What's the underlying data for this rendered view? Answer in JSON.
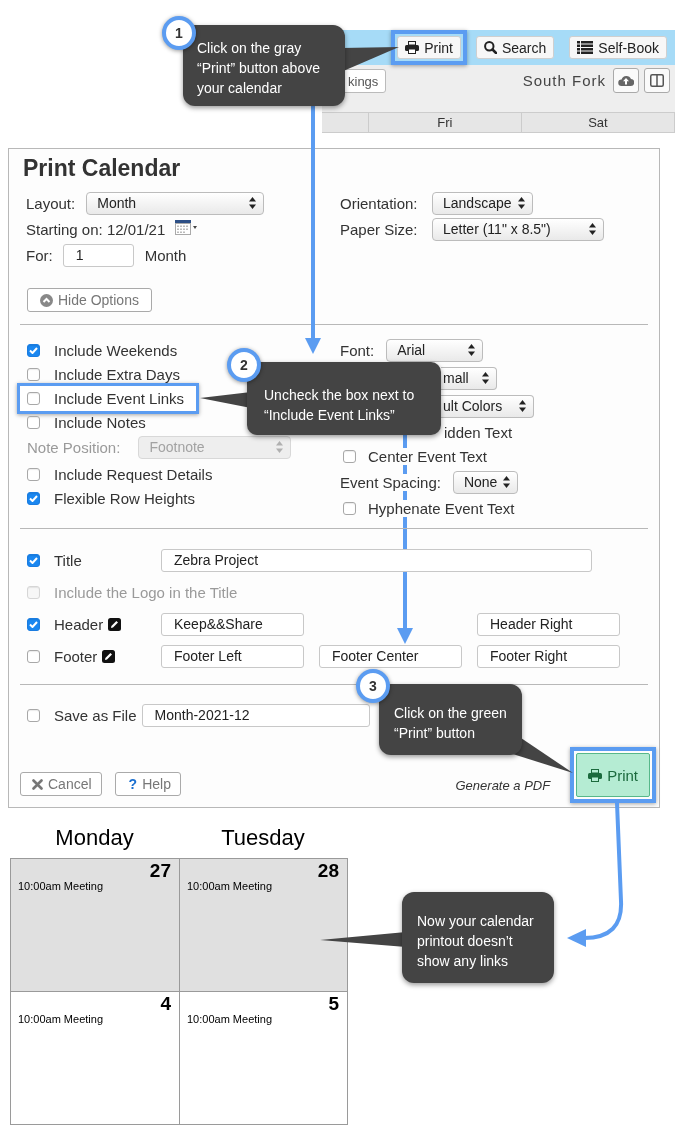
{
  "annotations": {
    "callouts": [
      {
        "number": "1",
        "text": "Click on the gray “Print” button above your calendar"
      },
      {
        "number": "2",
        "text": "Uncheck the box next to “Include Event Links”"
      },
      {
        "number": "3",
        "text": "Click on the green “Print” button"
      },
      {
        "text": "Now your calendar printout doesn’t show any links"
      }
    ]
  },
  "calendar_app": {
    "toolbar": [
      {
        "kind": "print",
        "label": "Print",
        "highlighted": true
      },
      {
        "kind": "search",
        "label": "Search",
        "highlighted": false
      },
      {
        "kind": "self_book",
        "label": "Self-Book",
        "highlighted": false
      }
    ],
    "bookings_button": "kings",
    "location": "South Fork",
    "day_headers": [
      "Fri",
      "Sat"
    ]
  },
  "print_dialog": {
    "title": "Print Calendar",
    "layout": {
      "label": "Layout:",
      "value": "Month"
    },
    "starting_on": "Starting on: 12/01/21",
    "duration": {
      "label": "For:",
      "value": "1",
      "unit": "Month"
    },
    "orientation": {
      "label": "Orientation:",
      "value": "Landscape"
    },
    "paper_size": {
      "label": "Paper Size:",
      "value": "Letter (11\" x 8.5\")"
    },
    "hide_options": "Hide Options",
    "left_options": [
      {
        "kind": "check",
        "label": "Include Weekends",
        "checked": true,
        "disabled": false,
        "highlighted": false
      },
      {
        "kind": "check",
        "label": "Include Extra Days",
        "checked": false,
        "disabled": false,
        "highlighted": false
      },
      {
        "kind": "check",
        "label": "Include Event Links",
        "checked": false,
        "disabled": false,
        "highlighted": true
      },
      {
        "kind": "check",
        "label": "Include Notes",
        "checked": false,
        "disabled": false,
        "highlighted": false
      },
      {
        "kind": "select",
        "label": "Note Position:",
        "value": "Footnote",
        "disabled": true,
        "highlighted": false
      },
      {
        "kind": "check",
        "label": "Include Request Details",
        "checked": false,
        "disabled": false,
        "highlighted": false
      },
      {
        "kind": "check",
        "label": "Flexible Row Heights",
        "checked": true,
        "disabled": false,
        "highlighted": false
      }
    ],
    "right_options": [
      {
        "kind": "select",
        "label": "Font:",
        "value": "Arial"
      },
      {
        "kind": "select",
        "value": "mall"
      },
      {
        "kind": "select",
        "value": "ult Colors"
      },
      {
        "kind": "text",
        "label": "idden Text"
      },
      {
        "kind": "check",
        "label": "Center Event Text",
        "checked": false
      },
      {
        "kind": "select",
        "label": "Event Spacing:",
        "value": "None"
      },
      {
        "kind": "check",
        "label": "Hyphenate Event Text",
        "checked": false
      }
    ],
    "page_options": [
      {
        "kind": "wide",
        "label": "Title",
        "checked": true,
        "disabled": false,
        "fields": {
          "left": "Zebra Project"
        }
      },
      {
        "kind": "plain",
        "label": "Include the Logo in the Title",
        "checked": false,
        "disabled": true
      },
      {
        "kind": "edit",
        "label": "Header",
        "checked": true,
        "disabled": false,
        "fields": {
          "left": "Keep&&Share",
          "right": "Header Right"
        }
      },
      {
        "kind": "edit",
        "label": "Footer",
        "checked": false,
        "disabled": false,
        "fields": {
          "left": "Footer Left",
          "center": "Footer Center",
          "right": "Footer Right"
        }
      }
    ],
    "save_as_file": {
      "label": "Save as File",
      "checked": false,
      "value": "Month-2021-12"
    },
    "cancel_button": "Cancel",
    "help_button": {
      "icon": "?",
      "label": "Help"
    },
    "pdf_note": "Generate a PDF",
    "print_button": {
      "label": "Print",
      "highlighted": true
    }
  },
  "printout": {
    "day_names": [
      "Monday",
      "Tuesday"
    ],
    "weeks": [
      {
        "shaded": true,
        "days": [
          {
            "date": "27",
            "events": [
              "10:00am Meeting"
            ]
          },
          {
            "date": "28",
            "events": [
              "10:00am Meeting"
            ]
          }
        ]
      },
      {
        "shaded": false,
        "days": [
          {
            "date": "4",
            "events": [
              "10:00am Meeting"
            ]
          },
          {
            "date": "5",
            "events": [
              "10:00am Meeting"
            ]
          }
        ]
      }
    ]
  }
}
